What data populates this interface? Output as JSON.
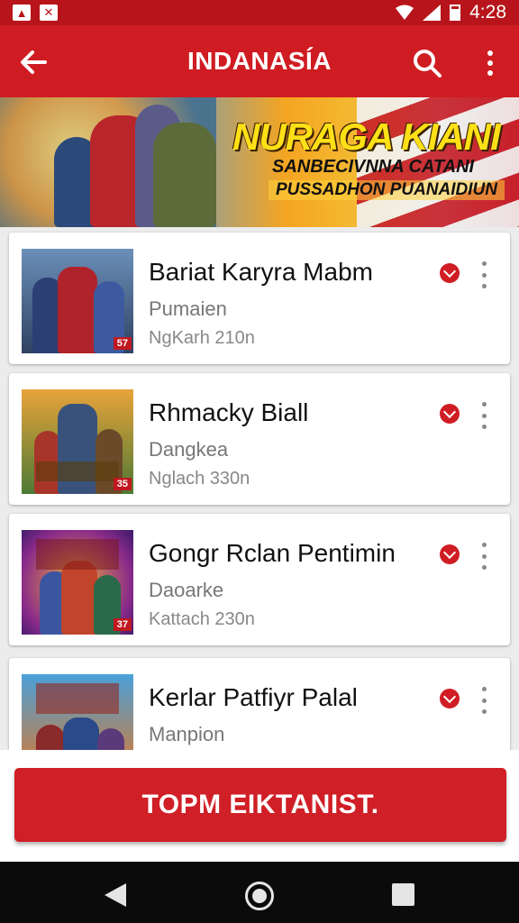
{
  "status_bar": {
    "time": "4:28",
    "left_icons": [
      "notification-icon",
      "tools-icon"
    ],
    "right_icons": [
      "wifi-icon",
      "signal-icon",
      "battery-icon"
    ]
  },
  "app_bar": {
    "title": "INDANASÍA",
    "icons": [
      "back-arrow-icon",
      "search-icon",
      "more-vert-icon"
    ]
  },
  "banner": {
    "title": "NURAGA KIANI",
    "line1": "SANBECIVNNA CATANI",
    "line2": "PUSSADHON PUANAIDIUN"
  },
  "list": {
    "items": [
      {
        "title": "Bariat Karyra Mabm",
        "subtitle": "Pumaien",
        "meta": "NgKarh 210n",
        "badge": "57"
      },
      {
        "title": "Rhmacky Biall",
        "subtitle": "Dangkea",
        "meta": "Nglach 330n",
        "badge": "35"
      },
      {
        "title": "Gongr Rclan Pentimin",
        "subtitle": "Daoarke",
        "meta": "Kattach 230n",
        "badge": "37"
      },
      {
        "title": "Kerlar Patfiyr Palal",
        "subtitle": "Manpion",
        "meta": "",
        "badge": ""
      }
    ]
  },
  "cta": {
    "label": "TOPM EIKTANIST."
  },
  "colors": {
    "primary": "#cf1c22",
    "status_bar": "#b7151b",
    "nav_bar": "#0b0b0b"
  }
}
